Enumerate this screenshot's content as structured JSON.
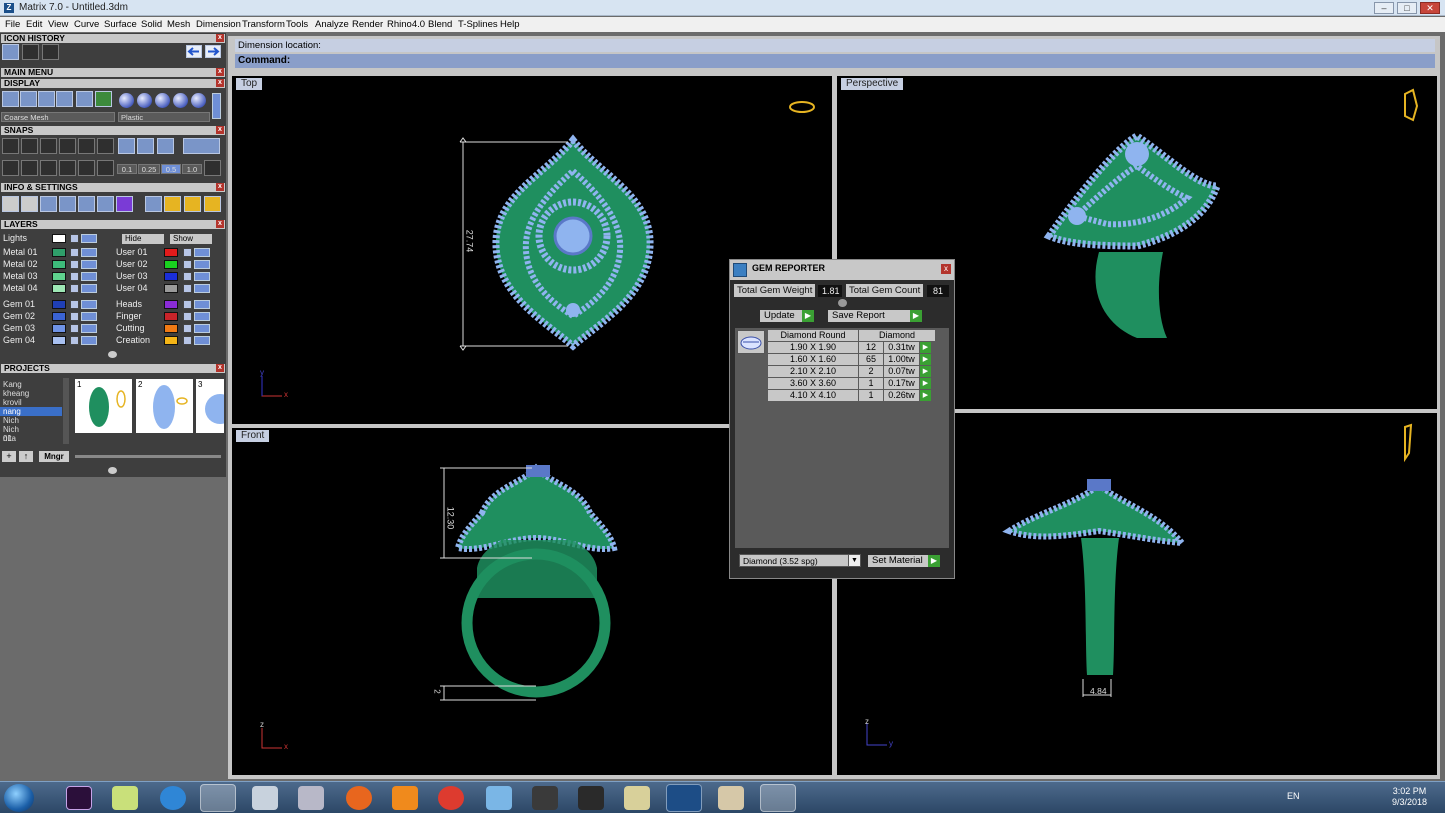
{
  "window": {
    "title": "Matrix 7.0 - Untitled.3dm",
    "app_icon": "matrix-z-icon",
    "min": "–",
    "max": "□",
    "close": "✕"
  },
  "menu": [
    "File",
    "Edit",
    "View",
    "Curve",
    "Surface",
    "Solid",
    "Mesh",
    "Dimension",
    "Transform",
    "Tools",
    "Analyze",
    "Render",
    "Rhino4.0",
    "Blend",
    "T-Splines",
    "Help"
  ],
  "panel": {
    "icon_history": "ICON HISTORY",
    "main_menu": "MAIN MENU",
    "display": "DISPLAY",
    "display_mode": "Coarse Mesh",
    "display_material": "Plastic",
    "snaps": "SNAPS",
    "snap_values": [
      "0.1",
      "0.25",
      "0.5",
      "1.0"
    ],
    "info_settings": "INFO & SETTINGS",
    "layers": "LAYERS",
    "lights": "Lights",
    "hide": "Hide",
    "show": "Show",
    "layers_left": [
      {
        "name": "Metal 01",
        "color": "#2f9f6a"
      },
      {
        "name": "Metal 02",
        "color": "#3dbb7b"
      },
      {
        "name": "Metal 03",
        "color": "#5fd38e"
      },
      {
        "name": "Metal 04",
        "color": "#9ee8b5"
      },
      {
        "name": "Gem 01",
        "color": "#1f3fb5"
      },
      {
        "name": "Gem 02",
        "color": "#3a63d4"
      },
      {
        "name": "Gem 03",
        "color": "#6f93e6"
      },
      {
        "name": "Gem 04",
        "color": "#a8c0f0"
      }
    ],
    "layers_right": [
      {
        "name": "User 01",
        "color": "#e21b1b"
      },
      {
        "name": "User 02",
        "color": "#19d11f"
      },
      {
        "name": "User 03",
        "color": "#1a2ed8"
      },
      {
        "name": "User 04",
        "color": "#9a9a9a"
      },
      {
        "name": "Heads",
        "color": "#8a2bd6"
      },
      {
        "name": "Finger",
        "color": "#c8242a"
      },
      {
        "name": "Cutting",
        "color": "#f07a14"
      },
      {
        "name": "Creation",
        "color": "#f5b517"
      }
    ],
    "projects": "PROJECTS",
    "project_list": [
      "Kang",
      "kheang",
      "krovil",
      "nang",
      "Nich",
      "Nich 01",
      "nita"
    ],
    "selected_project": "nang",
    "thumb_numbers": [
      "1",
      "2",
      "3"
    ],
    "mngr": "Mngr"
  },
  "command": {
    "dimension_location": "Dimension location:",
    "command_label": "Command:"
  },
  "viewports": {
    "top": "Top",
    "perspective": "Perspective",
    "front": "Front",
    "dim_top": "27.74",
    "dim_front": "12.30",
    "dim_front_small": "2",
    "dim_right": "4.84",
    "axis_x": "x",
    "axis_y": "y",
    "axis_z": "z"
  },
  "gem_reporter": {
    "title": "GEM REPORTER",
    "total_weight_label": "Total Gem Weight",
    "total_weight": "1.81",
    "total_count_label": "Total Gem Count",
    "total_count": "81",
    "update": "Update",
    "save_report": "Save Report",
    "col_shape": "Diamond Round",
    "col_material": "Diamond",
    "rows": [
      {
        "size": "1.90 X 1.90",
        "count": "12",
        "weight": "0.31tw"
      },
      {
        "size": "1.60 X 1.60",
        "count": "65",
        "weight": "1.00tw"
      },
      {
        "size": "2.10 X 2.10",
        "count": "2",
        "weight": "0.07tw"
      },
      {
        "size": "3.60 X 3.60",
        "count": "1",
        "weight": "0.17tw"
      },
      {
        "size": "4.10 X 4.10",
        "count": "1",
        "weight": "0.26tw"
      }
    ],
    "material_select": "Diamond    (3.52 spg)",
    "set_material": "Set Material"
  },
  "taskbar": {
    "lang": "EN",
    "time": "3:02 PM",
    "date": "9/3/2018"
  }
}
